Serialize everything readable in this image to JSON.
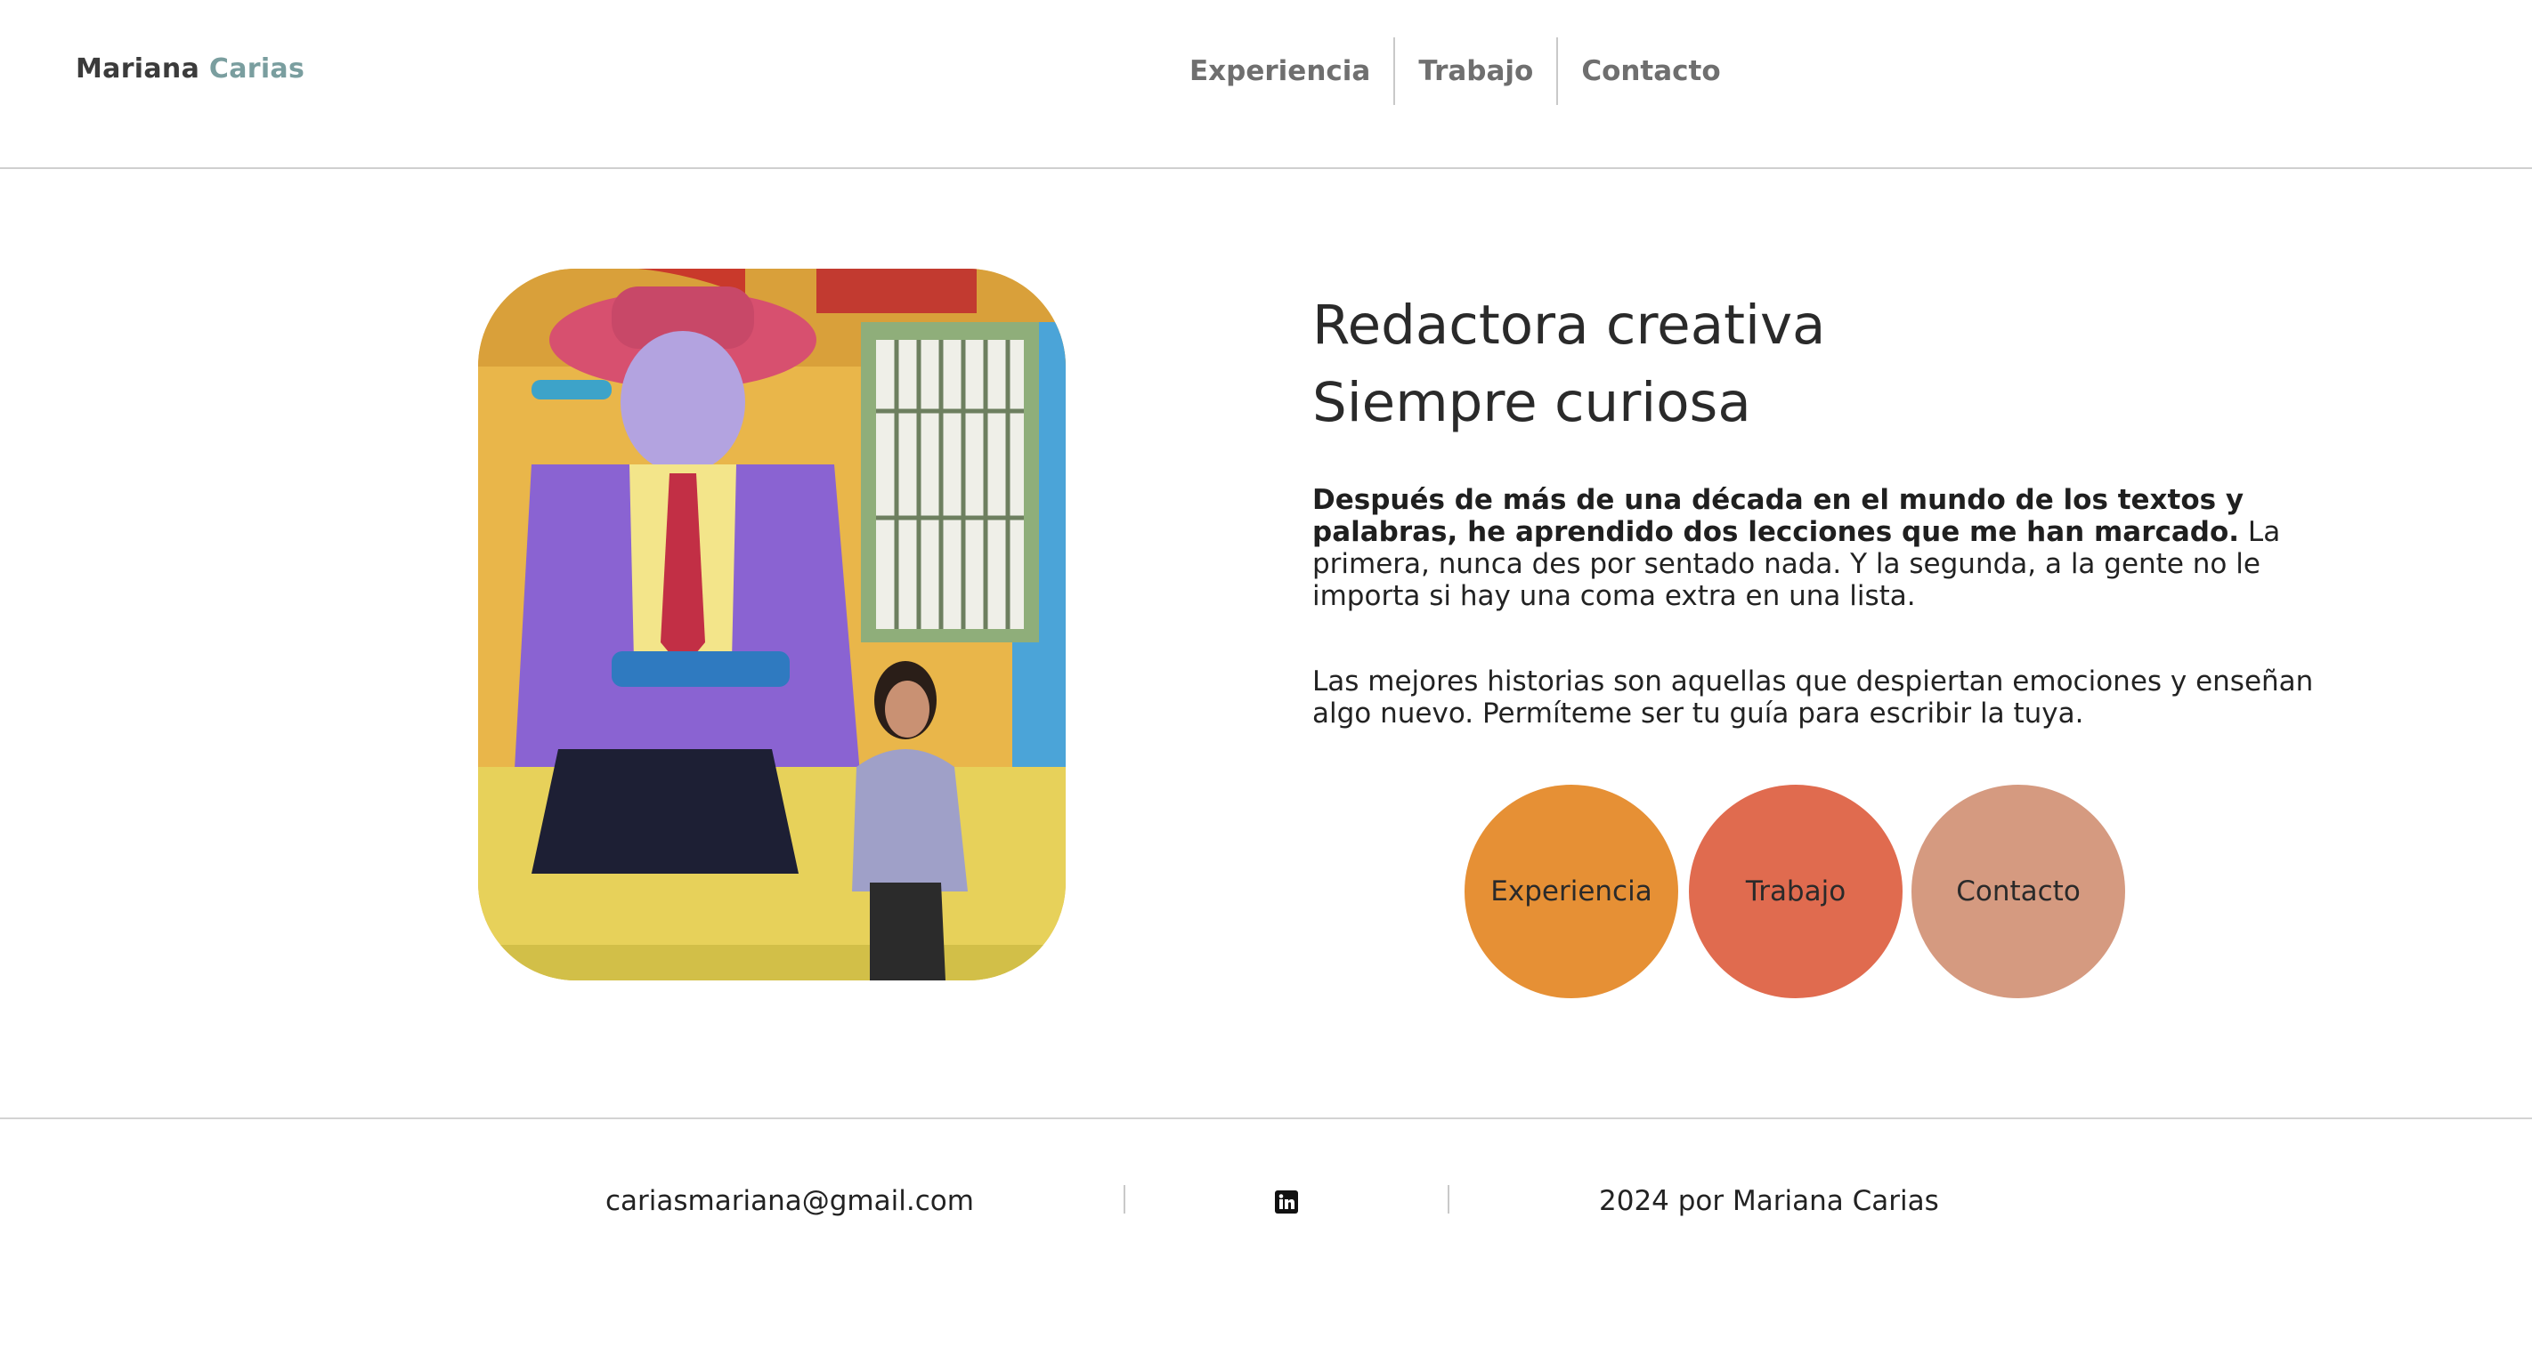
{
  "header": {
    "brand_first": "Mariana",
    "brand_last": "Carias",
    "nav": [
      "Experiencia",
      "Trabajo",
      "Contacto"
    ]
  },
  "hero": {
    "headline_line1": "Redactora creativa",
    "headline_line2": "Siempre curiosa",
    "para1_bold": "Después de más de una década en el mundo de los textos y palabras, he aprendido dos lecciones que me han marcado.",
    "para1_rest": " La primera, nunca des por sentado nada. Y la segunda, a la gente no le importa si hay una coma extra en una lista.",
    "para2": "Las mejores historias son aquellas que despiertan emociones y enseñan algo nuevo. Permíteme ser tu guía para escribir la tuya.",
    "buttons": [
      "Experiencia",
      "Trabajo",
      "Contacto"
    ]
  },
  "footer": {
    "email": "cariasmariana@gmail.com",
    "social_icon": "linkedin-icon",
    "copyright": "2024 por Mariana Carias"
  },
  "colors": {
    "brand_accent": "#7a9e9f",
    "button_experiencia": "#e69035",
    "button_trabajo": "#e06b4f",
    "button_contacto": "#d59a80"
  }
}
